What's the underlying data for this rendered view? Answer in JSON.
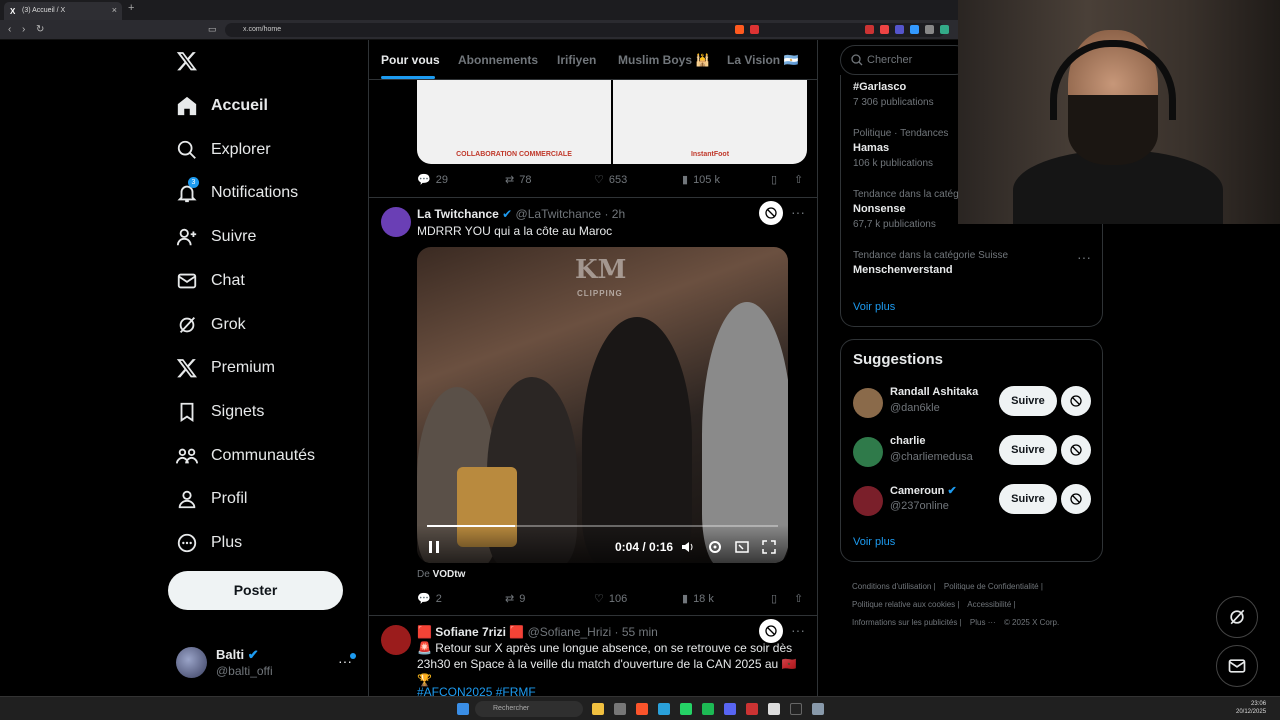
{
  "browser": {
    "tab_title": "(3) Accueil / X",
    "tab_favicon": "X",
    "url": "x.com/home"
  },
  "nav": {
    "items": [
      {
        "label": "Accueil",
        "icon": "home-icon"
      },
      {
        "label": "Explorer",
        "icon": "search-icon"
      },
      {
        "label": "Notifications",
        "icon": "bell-icon",
        "badge": "3"
      },
      {
        "label": "Suivre",
        "icon": "person-add-icon"
      },
      {
        "label": "Chat",
        "icon": "envelope-icon"
      },
      {
        "label": "Grok",
        "icon": "grok-icon"
      },
      {
        "label": "Premium",
        "icon": "x-icon"
      },
      {
        "label": "Signets",
        "icon": "bookmark-icon"
      },
      {
        "label": "Communautés",
        "icon": "communities-icon"
      },
      {
        "label": "Profil",
        "icon": "person-icon"
      },
      {
        "label": "Plus",
        "icon": "more-circle-icon"
      }
    ],
    "post_button": "Poster",
    "account": {
      "name": "Balti",
      "handle": "@balti_offi"
    }
  },
  "feed": {
    "tabs": [
      "Pour vous",
      "Abonnements",
      "Irifiyen",
      "Muslim Boys 🕌",
      "La Vision 🇦🇷"
    ],
    "ad_captions": [
      "COLLABORATION COMMERCIALE",
      "InstantFoot"
    ],
    "post0_stats": {
      "replies": "29",
      "reposts": "78",
      "likes": "653",
      "views": "105 k"
    },
    "post1": {
      "name": "La Twitchance",
      "handle": "@LaTwitchance",
      "time": "· 2h",
      "text": "MDRRR YOU qui a la côte au Maroc",
      "video_time": "0:04 / 0:16",
      "video_progress": 0.25,
      "watermark": "KM",
      "watermark_sub": "CLIPPING",
      "from_prefix": "De",
      "from_source": "VODtw",
      "stats": {
        "replies": "2",
        "reposts": "9",
        "likes": "106",
        "views": "18 k"
      }
    },
    "post2": {
      "name": "🟥 Sofiane 7rizi 🟥",
      "handle": "@Sofiane_Hrizi",
      "time": "· 55 min",
      "text": "🚨 Retour sur X après une longue absence, on se retrouve ce soir dès 23h30 en Space à la veille du match d'ouverture de la CAN 2025 au 🇲🇦🏆",
      "hashtags": "#AFCON2025 #FRMF"
    }
  },
  "sidebar": {
    "search_placeholder": "Chercher",
    "trends": [
      {
        "context": "",
        "topic": "#Garlasco",
        "count": "7 306 publications"
      },
      {
        "context": "Politique · Tendances",
        "topic": "Hamas",
        "count": "106 k publications"
      },
      {
        "context": "Tendance dans la catégorie",
        "topic": "Nonsense",
        "count": "67,7 k publications"
      },
      {
        "context": "Tendance dans la catégorie Suisse",
        "topic": "Menschenverstand",
        "count": ""
      }
    ],
    "trends_more": "Voir plus",
    "suggestions_title": "Suggestions",
    "suggestions": [
      {
        "name": "Randall Ashitaka",
        "handle": "@dan6kle",
        "button": "Suivre"
      },
      {
        "name": "charlie",
        "handle": "@charliemedusa",
        "button": "Suivre"
      },
      {
        "name": "Cameroun",
        "handle": "@237online",
        "button": "Suivre"
      }
    ],
    "suggestions_more": "Voir plus",
    "footer_links": [
      "Conditions d'utilisation |",
      "Politique de Confidentialité |",
      "Politique relative aux cookies |",
      "Accessibilité |",
      "Informations sur les publicités |",
      "Plus ···",
      "© 2025 X Corp."
    ]
  },
  "taskbar": {
    "search_placeholder": "Rechercher",
    "time": "23:06",
    "date": "20/12/2025"
  },
  "colors": {
    "accent": "#1d9bf0",
    "background": "#000000",
    "text": "#e7e9ea",
    "muted": "#71767b"
  }
}
